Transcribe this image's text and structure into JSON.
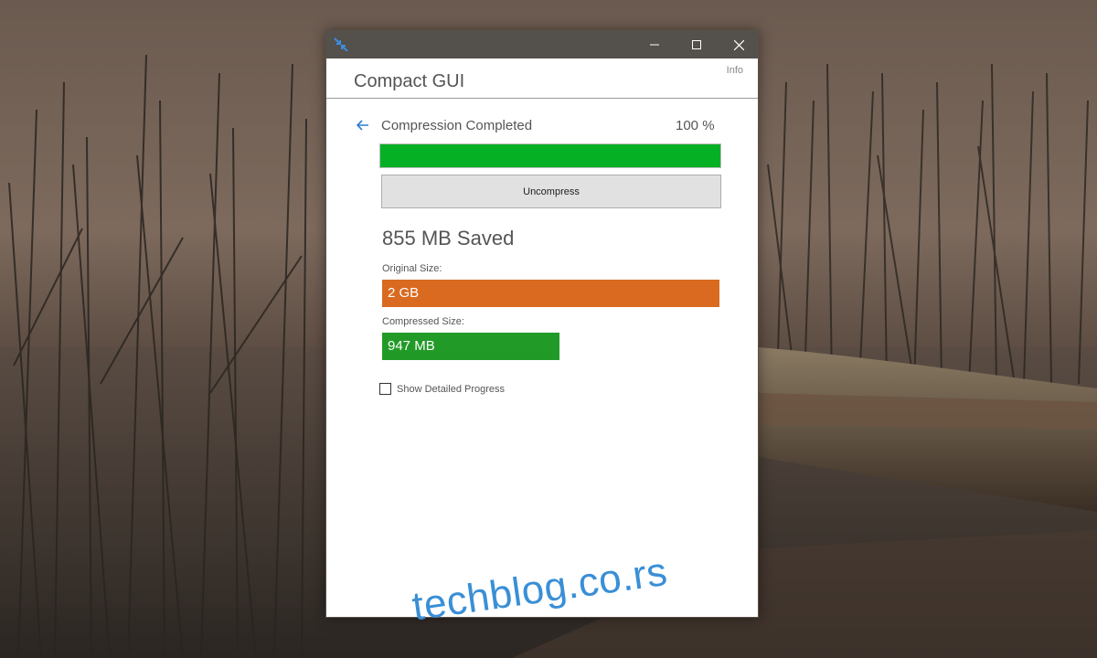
{
  "window": {
    "title": "Compact GUI",
    "info_link": "Info",
    "controls": [
      "minimize-icon",
      "maximize-icon",
      "close-icon"
    ]
  },
  "status": {
    "text": "Compression Completed",
    "percent_text": "100 %",
    "progress": 1.0
  },
  "actions": {
    "uncompress_label": "Uncompress"
  },
  "results": {
    "saved_text": "855 MB Saved",
    "original_label": "Original Size:",
    "original_value": "2 GB",
    "compressed_label": "Compressed Size:",
    "compressed_value": "947 MB",
    "compressed_fraction": 0.47
  },
  "options": {
    "show_detailed_label": "Show Detailed Progress",
    "show_detailed_checked": false
  },
  "watermark": "techblog.co.rs",
  "colors": {
    "titlebar": "#54504b",
    "progress_fill": "#06b025",
    "original_bar": "#d96a20",
    "compressed_bar": "#229a27",
    "accent_icon": "#2f7fd1"
  }
}
